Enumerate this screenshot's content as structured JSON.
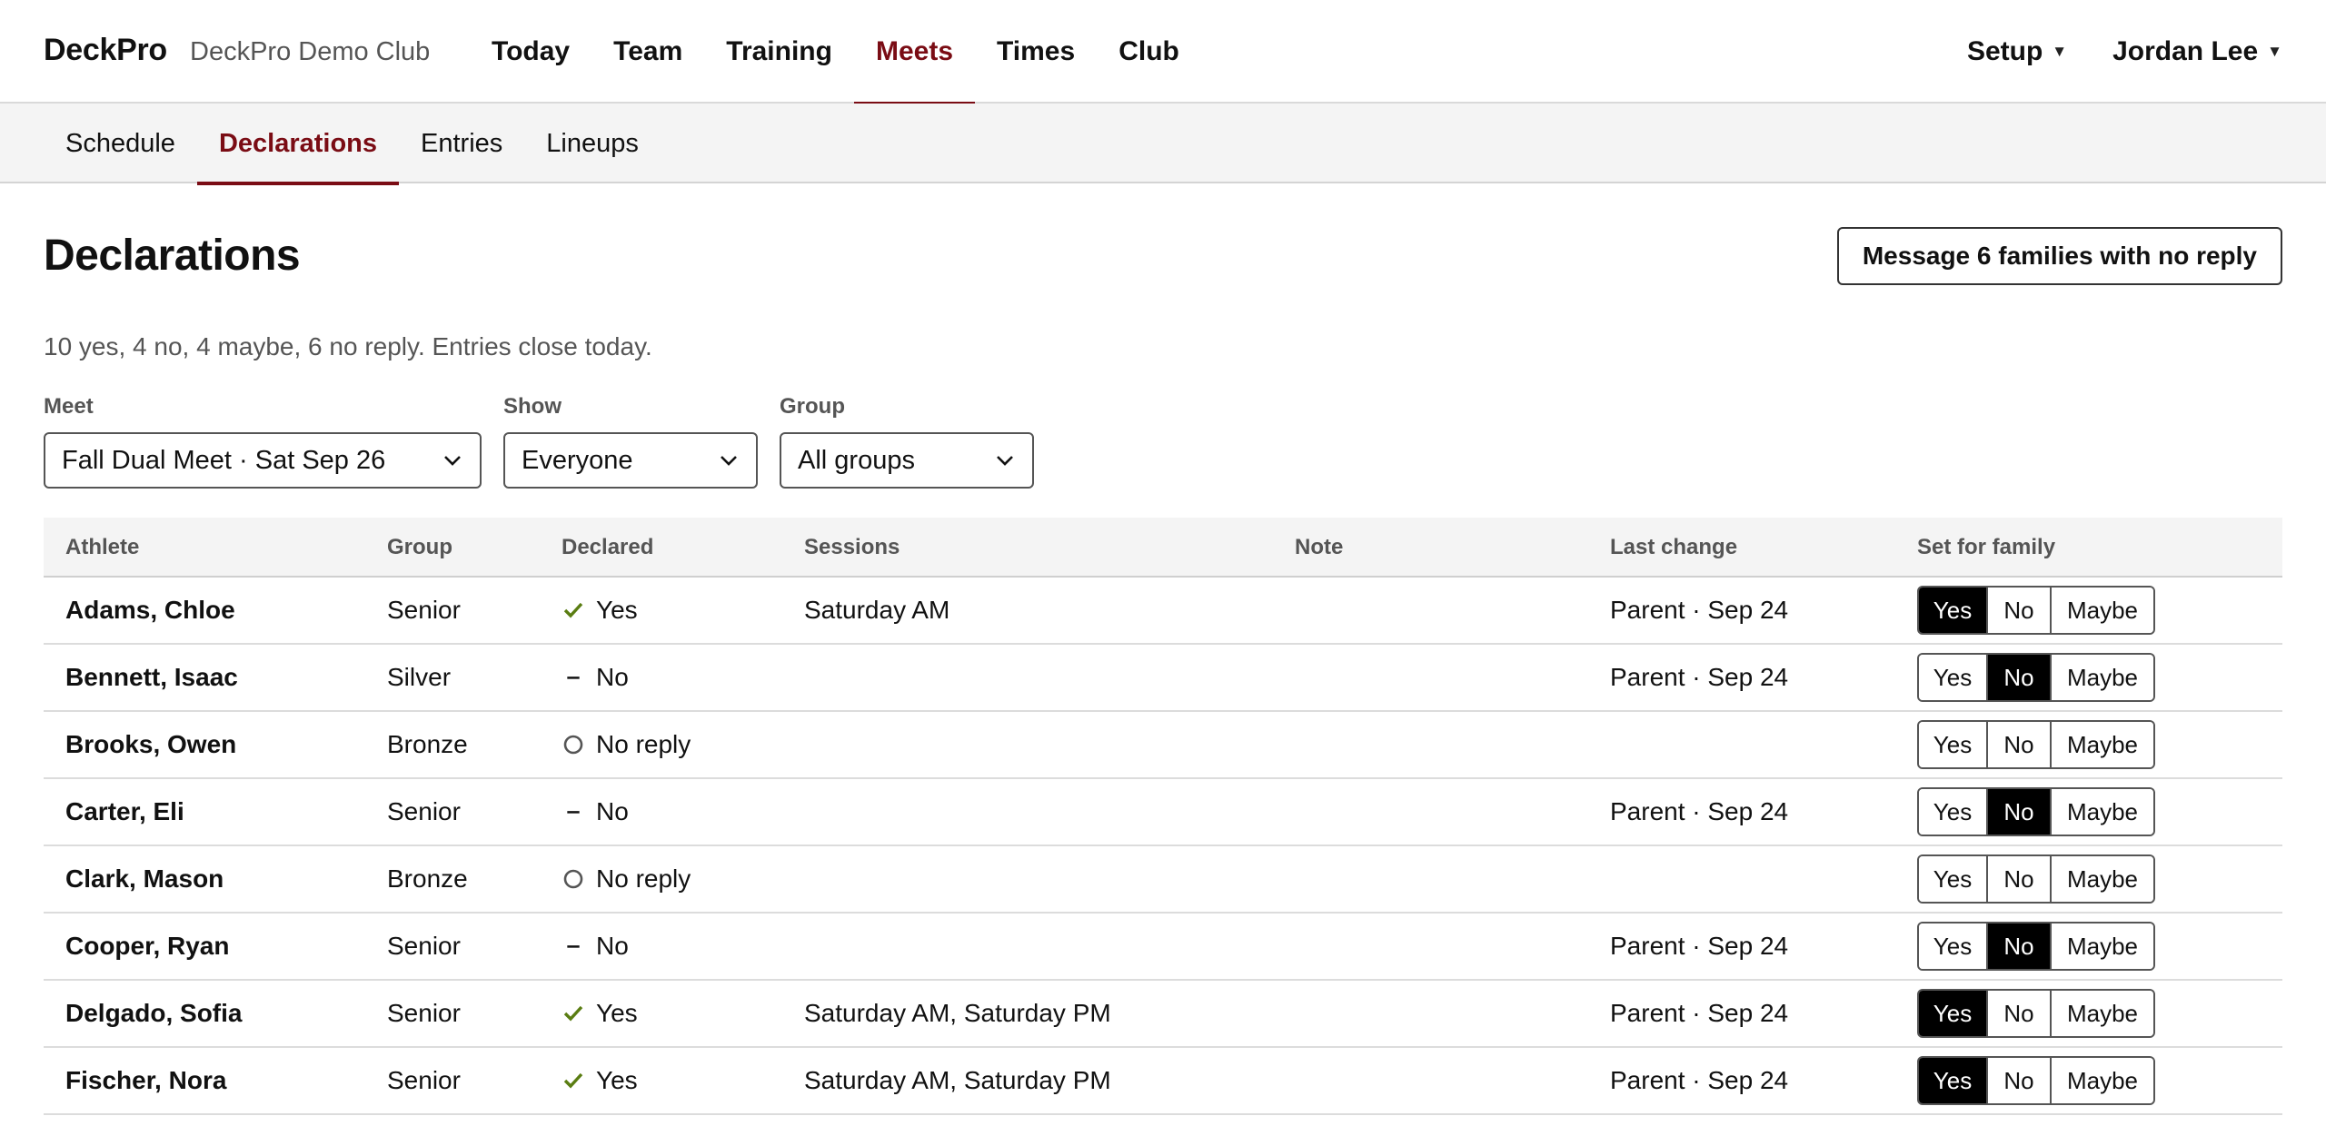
{
  "app": {
    "brand": "DeckPro",
    "club": "DeckPro Demo Club"
  },
  "nav": {
    "items": [
      {
        "label": "Today"
      },
      {
        "label": "Team"
      },
      {
        "label": "Training"
      },
      {
        "label": "Meets"
      },
      {
        "label": "Times"
      },
      {
        "label": "Club"
      }
    ],
    "active": "Meets",
    "setup": "Setup",
    "user": "Jordan Lee"
  },
  "subnav": {
    "items": [
      {
        "label": "Schedule"
      },
      {
        "label": "Declarations"
      },
      {
        "label": "Entries"
      },
      {
        "label": "Lineups"
      }
    ],
    "active": "Declarations"
  },
  "page": {
    "title": "Declarations",
    "message_button": "Message 6 families with no reply",
    "summary": "10 yes, 4 no, 4 maybe, 6 no reply. Entries close today."
  },
  "filters": {
    "meet": {
      "label": "Meet",
      "value": "Fall Dual Meet · Sat Sep 26"
    },
    "show": {
      "label": "Show",
      "value": "Everyone"
    },
    "group": {
      "label": "Group",
      "value": "All groups"
    }
  },
  "table": {
    "headers": {
      "athlete": "Athlete",
      "group": "Group",
      "declared": "Declared",
      "sessions": "Sessions",
      "note": "Note",
      "last_change": "Last change",
      "set_for_family": "Set for family"
    },
    "options": {
      "yes": "Yes",
      "no": "No",
      "maybe": "Maybe"
    },
    "rows": [
      {
        "athlete": "Adams, Chloe",
        "group": "Senior",
        "declared": "Yes",
        "status": "yes",
        "sessions": "Saturday AM",
        "note": "",
        "last_change": "Parent · Sep 24"
      },
      {
        "athlete": "Bennett, Isaac",
        "group": "Silver",
        "declared": "No",
        "status": "no",
        "sessions": "",
        "note": "",
        "last_change": "Parent · Sep 24"
      },
      {
        "athlete": "Brooks, Owen",
        "group": "Bronze",
        "declared": "No reply",
        "status": "none",
        "sessions": "",
        "note": "",
        "last_change": ""
      },
      {
        "athlete": "Carter, Eli",
        "group": "Senior",
        "declared": "No",
        "status": "no",
        "sessions": "",
        "note": "",
        "last_change": "Parent · Sep 24"
      },
      {
        "athlete": "Clark, Mason",
        "group": "Bronze",
        "declared": "No reply",
        "status": "none",
        "sessions": "",
        "note": "",
        "last_change": ""
      },
      {
        "athlete": "Cooper, Ryan",
        "group": "Senior",
        "declared": "No",
        "status": "no",
        "sessions": "",
        "note": "",
        "last_change": "Parent · Sep 24"
      },
      {
        "athlete": "Delgado, Sofia",
        "group": "Senior",
        "declared": "Yes",
        "status": "yes",
        "sessions": "Saturday AM, Saturday PM",
        "note": "",
        "last_change": "Parent · Sep 24"
      },
      {
        "athlete": "Fischer, Nora",
        "group": "Senior",
        "declared": "Yes",
        "status": "yes",
        "sessions": "Saturday AM, Saturday PM",
        "note": "",
        "last_change": "Parent · Sep 24"
      }
    ]
  },
  "colors": {
    "accent": "#7a0c14",
    "check": "#5a7d12",
    "selected_bg": "#000000"
  },
  "icons": {
    "yes": "check-icon",
    "no": "dash-icon",
    "none": "circle-icon",
    "dropdown": "chevron-down-icon",
    "menu": "caret-down-icon"
  }
}
